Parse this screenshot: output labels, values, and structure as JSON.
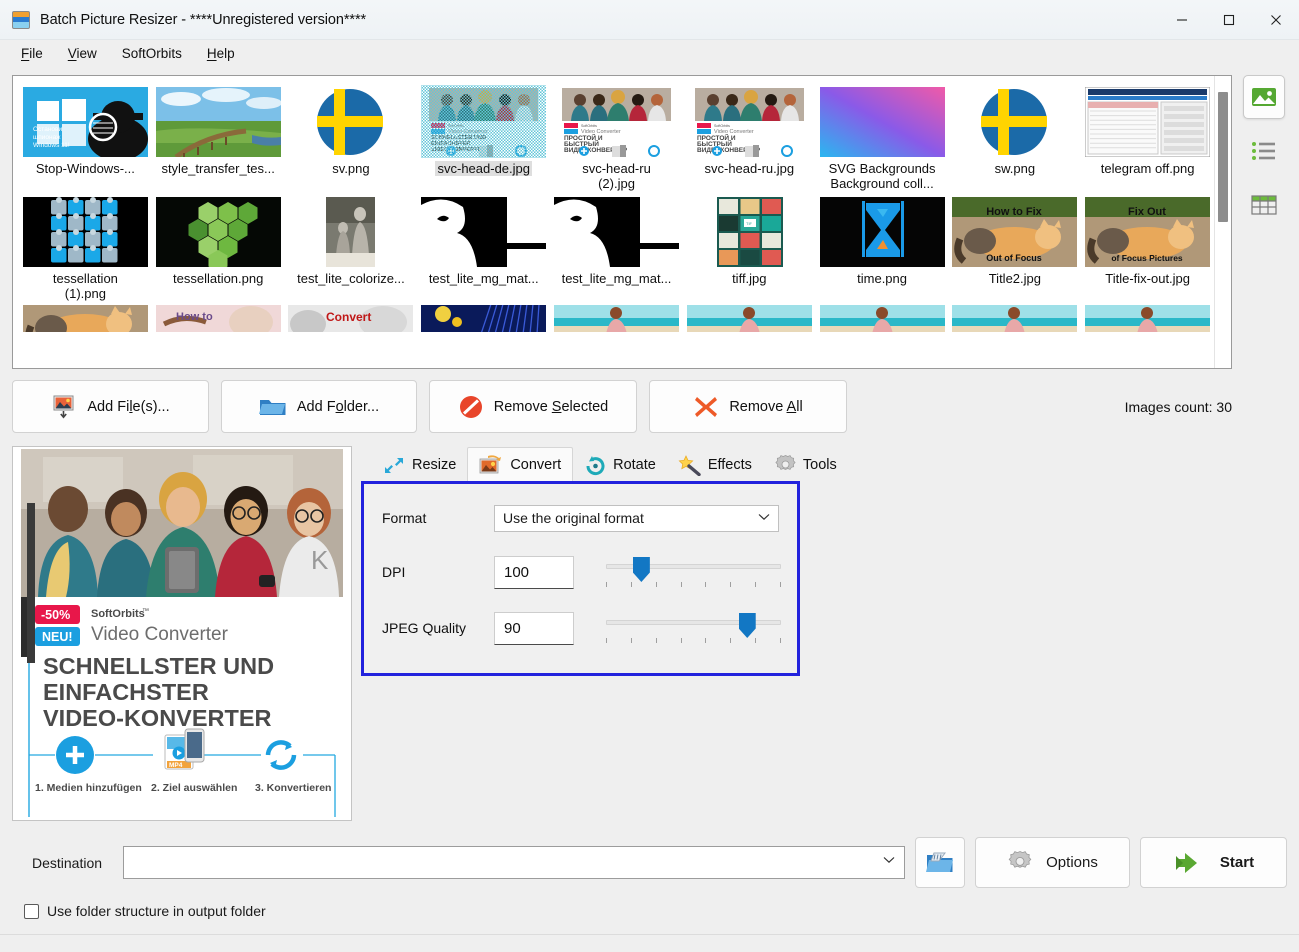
{
  "window": {
    "title": "Batch Picture Resizer - ****Unregistered version****",
    "app_icon": "app-image-icon",
    "minimize": "–",
    "maximize": "□",
    "close": "✕"
  },
  "menu": [
    {
      "label": "File",
      "accel": "F"
    },
    {
      "label": "View",
      "accel": "V"
    },
    {
      "label": "SoftOrbits",
      "accel": ""
    },
    {
      "label": "Help",
      "accel": "H"
    }
  ],
  "thumbnails": {
    "rows": [
      [
        {
          "caption": "Stop-Windows-...",
          "caption2": "",
          "kind": "stop-windows",
          "selected": false
        },
        {
          "caption": "style_transfer_tes...",
          "caption2": "",
          "kind": "landscape-bridge",
          "selected": false
        },
        {
          "caption": "sv.png",
          "caption2": "",
          "kind": "sweden-flag-circle",
          "selected": false
        },
        {
          "caption": "svc-head-de.jpg",
          "caption2": "",
          "kind": "ad-de",
          "selected": true
        },
        {
          "caption": "svc-head-ru",
          "caption2": "(2).jpg",
          "kind": "ad-ru",
          "selected": false
        },
        {
          "caption": "svc-head-ru.jpg",
          "caption2": "",
          "kind": "ad-ru",
          "selected": false
        },
        {
          "caption": "SVG Backgrounds",
          "caption2": "Background coll...",
          "kind": "svg-gradient",
          "selected": false
        },
        {
          "caption": "sw.png",
          "caption2": "",
          "kind": "sweden-flag-circle",
          "selected": false
        },
        {
          "caption": "telegram off.png",
          "caption2": "",
          "kind": "screenshot-ui",
          "selected": false
        }
      ],
      [
        {
          "caption": "tessellation",
          "caption2": "(1).png",
          "kind": "puzzle-blue",
          "selected": false
        },
        {
          "caption": "tessellation.png",
          "caption2": "",
          "kind": "hexagons-green",
          "selected": false
        },
        {
          "caption": "test_lite_colorize...",
          "caption2": "",
          "kind": "bw-photo",
          "selected": false
        },
        {
          "caption": "test_lite_mg_mat...",
          "caption2": "",
          "kind": "mask-silhouette",
          "selected": false
        },
        {
          "caption": "test_lite_mg_mat...",
          "caption2": "",
          "kind": "mask-silhouette",
          "selected": false
        },
        {
          "caption": "tiff.jpg",
          "caption2": "",
          "kind": "tif-icons",
          "selected": false
        },
        {
          "caption": "time.png",
          "caption2": "",
          "kind": "hourglass-x",
          "selected": false
        },
        {
          "caption": "Title2.jpg",
          "caption2": "",
          "kind": "cat-how-to-fix",
          "selected": false
        },
        {
          "caption": "Title-fix-out.jpg",
          "caption2": "",
          "kind": "cat-fix-out",
          "selected": false
        }
      ]
    ],
    "partial_row": [
      {
        "kind": "cat-fix-out"
      },
      {
        "kind": "how-to-pink"
      },
      {
        "kind": "convert-red"
      },
      {
        "kind": "blue-rays"
      },
      {
        "kind": "beach-woman"
      },
      {
        "kind": "beach-woman"
      },
      {
        "kind": "beach-woman"
      },
      {
        "kind": "beach-woman"
      },
      {
        "kind": "beach-woman"
      }
    ]
  },
  "view_modes": [
    {
      "name": "thumbnails-view",
      "icon": "image-icon",
      "active": true
    },
    {
      "name": "list-view",
      "icon": "list-icon",
      "active": false
    },
    {
      "name": "details-view",
      "icon": "table-icon",
      "active": false
    }
  ],
  "actions": {
    "add_files": "Add File(s)...",
    "add_files_pre": "Add Fi",
    "add_files_accel": "l",
    "add_files_post": "e(s)...",
    "add_folder_pre": "Add F",
    "add_folder_accel": "o",
    "add_folder_post": "lder...",
    "remove_selected_pre": "Remove ",
    "remove_selected_accel": "S",
    "remove_selected_post": "elected",
    "remove_all_pre": "Remove ",
    "remove_all_accel": "A",
    "remove_all_post": "ll",
    "images_count": "Images count: 30"
  },
  "preview": {
    "badge_discount": "-50%",
    "badge_new": "NEU!",
    "brand": "SoftOrbits",
    "brand_tm": "™",
    "product": "Video Converter",
    "headline_1": "SCHNELLSTER UND",
    "headline_2": "EINFACHSTER",
    "headline_3": "VIDEO-KONVERTER",
    "step1": "1. Medien hinzufügen",
    "step2": "2. Ziel auswählen",
    "step3": "3. Konvertieren",
    "mp4_label": "MP4"
  },
  "tabs": [
    {
      "label": "Resize",
      "icon": "resize-arrows-icon",
      "active": false
    },
    {
      "label": "Convert",
      "icon": "convert-image-icon",
      "active": true
    },
    {
      "label": "Rotate",
      "icon": "rotate-circle-icon",
      "active": false
    },
    {
      "label": "Effects",
      "icon": "magic-wand-icon",
      "active": false
    },
    {
      "label": "Tools",
      "icon": "gear-icon",
      "active": false
    }
  ],
  "convert_panel": {
    "highlight_color": "#2222dd",
    "format_label": "Format",
    "format_value": "Use the original format",
    "dpi_label": "DPI",
    "dpi_value": "100",
    "dpi_slider_percent": 17,
    "jpeg_label": "JPEG Quality",
    "jpeg_value": "90",
    "jpeg_slider_percent": 84,
    "slider_ticks": 8
  },
  "bottom": {
    "destination_label": "Destination",
    "destination_value": "",
    "browse_icon": "folder-browse-icon",
    "options_label": "Options",
    "options_icon": "gear-icon",
    "start_label": "Start",
    "start_icon": "green-arrow-icon",
    "checkbox_label": "Use folder structure in output folder",
    "checkbox_checked": false
  }
}
